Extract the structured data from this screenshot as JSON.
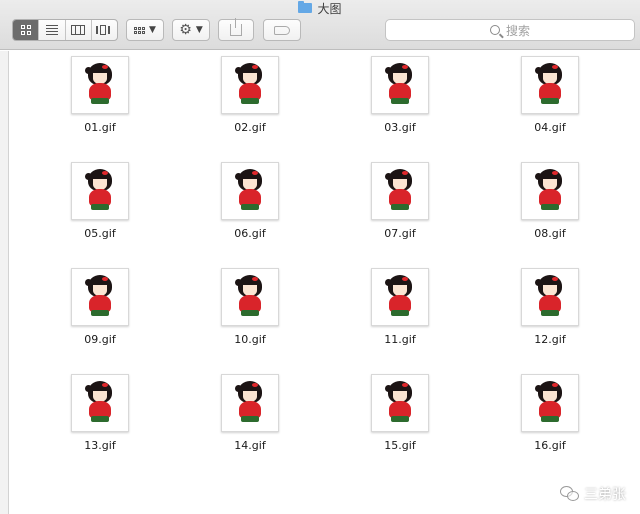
{
  "window": {
    "title": "大图"
  },
  "toolbar": {
    "view_modes": [
      {
        "name": "icon-view",
        "active": true
      },
      {
        "name": "list-view",
        "active": false
      },
      {
        "name": "column-view",
        "active": false
      },
      {
        "name": "cover-flow-view",
        "active": false
      }
    ],
    "icons": {
      "folder": "folder-icon",
      "arrange": "arrange-icon",
      "action": "gear-icon",
      "share": "share-icon",
      "tags": "tag-icon",
      "search": "search-icon"
    }
  },
  "search": {
    "placeholder": "搜索"
  },
  "files": [
    {
      "name": "01.gif"
    },
    {
      "name": "02.gif"
    },
    {
      "name": "03.gif"
    },
    {
      "name": "04.gif"
    },
    {
      "name": "05.gif"
    },
    {
      "name": "06.gif"
    },
    {
      "name": "07.gif"
    },
    {
      "name": "08.gif"
    },
    {
      "name": "09.gif"
    },
    {
      "name": "10.gif"
    },
    {
      "name": "11.gif"
    },
    {
      "name": "12.gif"
    },
    {
      "name": "13.gif"
    },
    {
      "name": "14.gif"
    },
    {
      "name": "15.gif"
    },
    {
      "name": "16.gif"
    }
  ],
  "watermark": {
    "text": "三弟张"
  },
  "colors": {
    "accent": "#64a8e6",
    "girl_dress": "#d9242a",
    "hair": "#1c1414"
  }
}
